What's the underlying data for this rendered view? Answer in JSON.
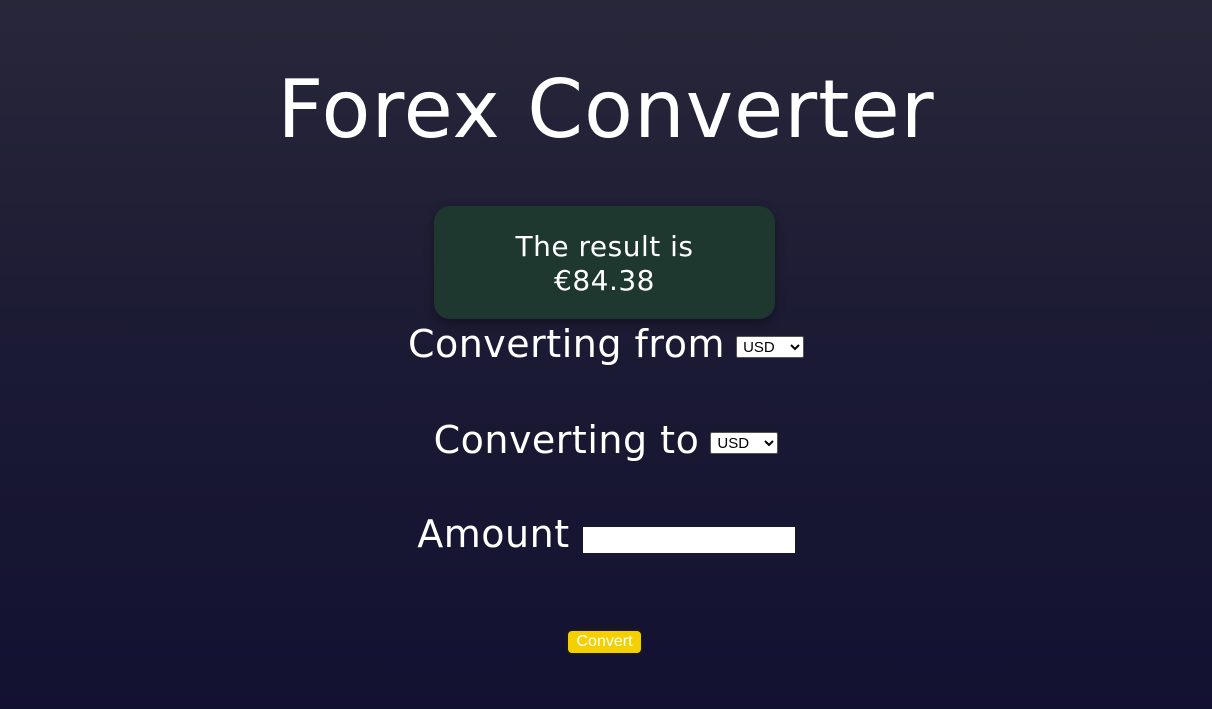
{
  "header": {
    "title": "Forex Converter"
  },
  "result": {
    "line1": "The result is",
    "line2": "€84.38"
  },
  "form": {
    "from_label": "Converting from",
    "from_value": "USD",
    "to_label": "Converting to",
    "to_value": "USD",
    "amount_label": "Amount",
    "amount_value": "",
    "convert_label": "Convert"
  },
  "colors": {
    "result_box_bg": "#1e3830",
    "button_bg": "#f5d000",
    "background_top": "#28273a",
    "background_bottom": "#121131"
  }
}
